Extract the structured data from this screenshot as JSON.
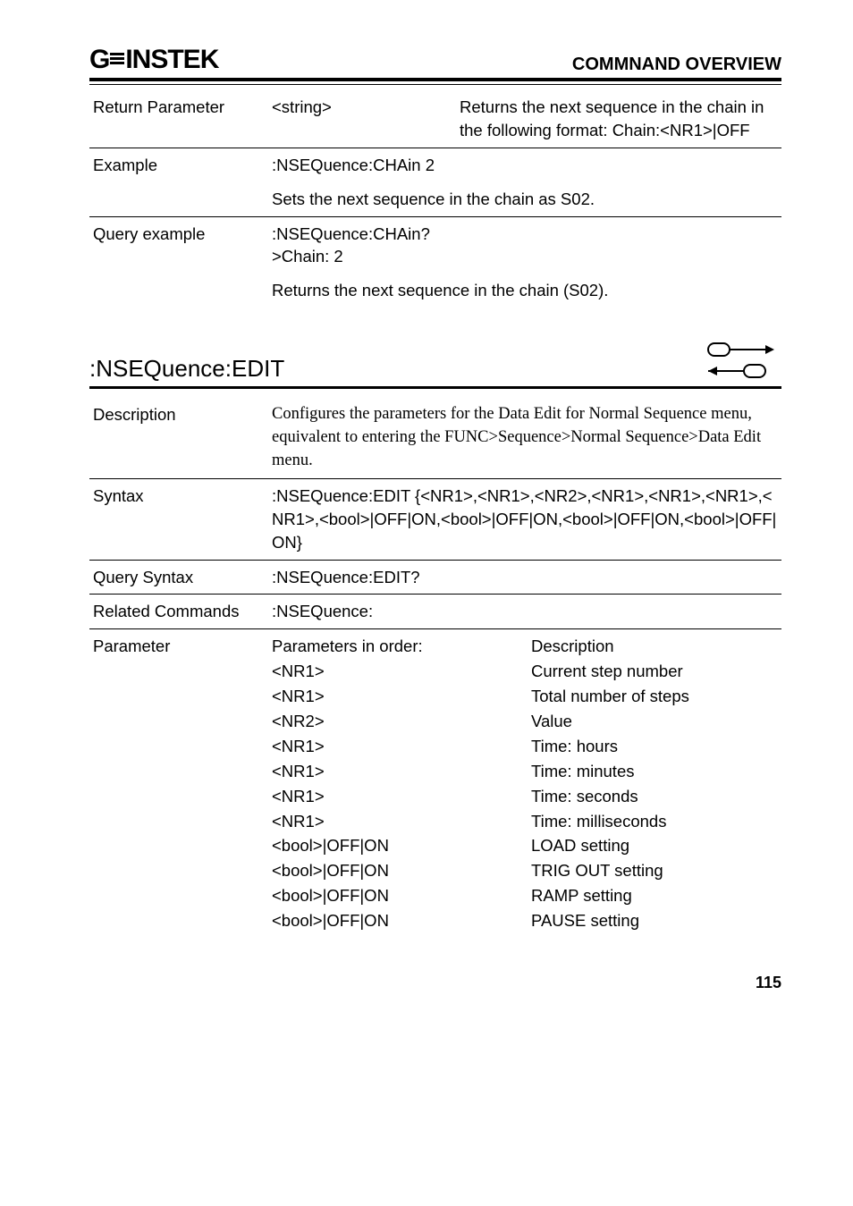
{
  "header": {
    "brand": "GWINSTEK",
    "title": "COMMNAND OVERVIEW"
  },
  "block1": {
    "return_param_label": "Return Parameter",
    "return_param_type": "<string>",
    "return_param_desc": "Returns the next sequence in the chain in the following format: Chain:<NR1>|OFF",
    "example_label": "Example",
    "example_cmd": ":NSEQuence:CHAin 2",
    "example_desc": "Sets the next sequence in the chain as S02.",
    "query_label": "Query example",
    "query_cmd": ":NSEQuence:CHAin?",
    "query_resp": ">Chain: 2",
    "query_desc": "Returns the next sequence in the chain (S02)."
  },
  "section": {
    "title": ":NSEQuence:EDIT"
  },
  "block2": {
    "desc_label": "Description",
    "desc_text": "Configures the parameters for the Data Edit for Normal Sequence menu, equivalent to entering the FUNC>Sequence>Normal Sequence>Data Edit menu.",
    "syntax_label": "Syntax",
    "syntax_text": ":NSEQuence:EDIT {<NR1>,<NR1>,<NR2>,<NR1>,<NR1>,<NR1>,<NR1>,<bool>|OFF|ON,<bool>|OFF|ON,<bool>|OFF|ON,<bool>|OFF|ON}",
    "qsyntax_label": "Query Syntax",
    "qsyntax_text": ":NSEQuence:EDIT?",
    "related_label": "Related Commands",
    "related_text": ":NSEQuence:",
    "param_label": "Parameter",
    "param_head_left": "Parameters in order:",
    "param_head_right": "Description",
    "params": [
      {
        "l": "<NR1>",
        "r": "Current step number"
      },
      {
        "l": "<NR1>",
        "r": "Total number of steps"
      },
      {
        "l": "<NR2>",
        "r": "Value"
      },
      {
        "l": "<NR1>",
        "r": "Time: hours"
      },
      {
        "l": "<NR1>",
        "r": "Time: minutes"
      },
      {
        "l": "<NR1>",
        "r": "Time: seconds"
      },
      {
        "l": "<NR1>",
        "r": "Time: milliseconds"
      },
      {
        "l": "<bool>|OFF|ON",
        "r": "LOAD setting"
      },
      {
        "l": "<bool>|OFF|ON",
        "r": "TRIG OUT setting"
      },
      {
        "l": "<bool>|OFF|ON",
        "r": "RAMP setting"
      },
      {
        "l": "<bool>|OFF|ON",
        "r": "PAUSE setting"
      }
    ]
  },
  "page_number": "115"
}
